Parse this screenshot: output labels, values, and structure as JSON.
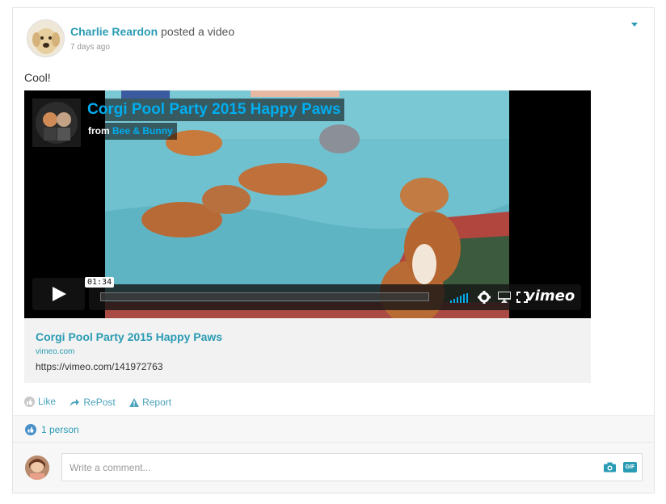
{
  "post": {
    "author": "Charlie Reardon",
    "action_text": "posted a video",
    "timestamp": "7 days ago",
    "text": "Cool!"
  },
  "video": {
    "title": "Corgi Pool Party 2015 Happy Paws",
    "from_label": "from",
    "channel": "Bee & Bunny",
    "time": "01:34",
    "brand": "vimeo"
  },
  "link_preview": {
    "title": "Corgi Pool Party 2015 Happy Paws",
    "domain": "vimeo.com",
    "url": "https://vimeo.com/141972763"
  },
  "actions": {
    "like": "Like",
    "repost": "RePost",
    "report": "Report"
  },
  "likes": {
    "count_label": "1 person"
  },
  "comment": {
    "placeholder": "Write a comment...",
    "gif_label": "GIF"
  },
  "colors": {
    "accent": "#2a9bb4",
    "vimeo_blue": "#00adef"
  }
}
